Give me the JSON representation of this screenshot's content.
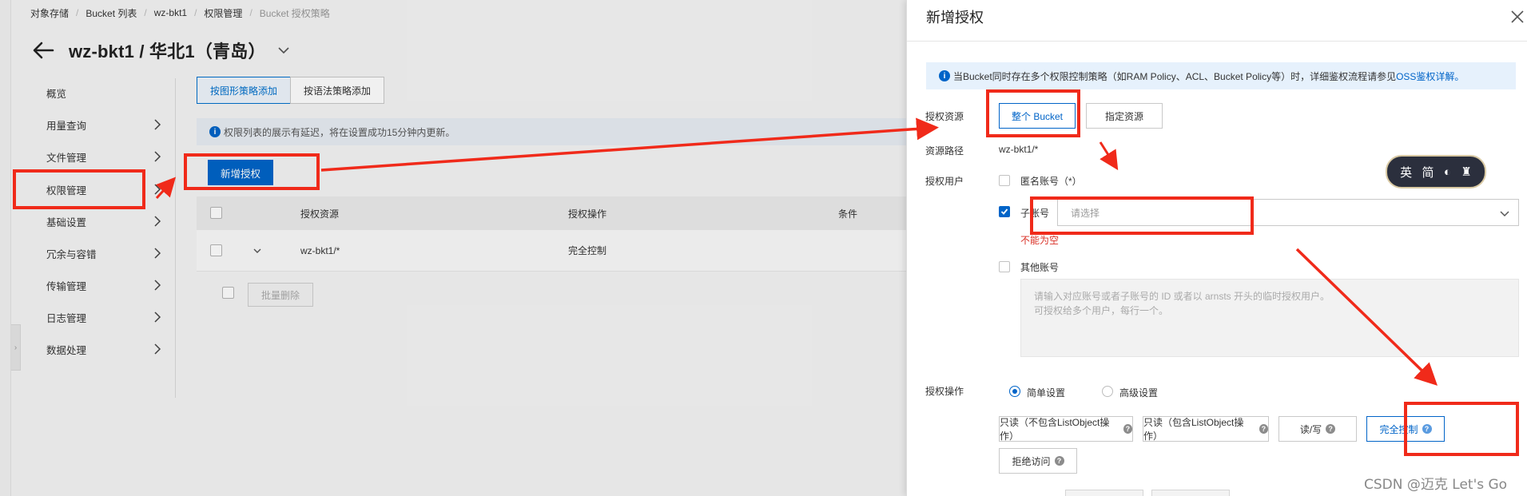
{
  "breadcrumb": [
    "对象存储",
    "Bucket 列表",
    "wz-bkt1",
    "权限管理",
    "Bucket 授权策略"
  ],
  "page": {
    "title": "wz-bkt1 / 华北1（青岛）"
  },
  "sidebar": {
    "items": [
      {
        "label": "概览",
        "has_arrow": false
      },
      {
        "label": "用量查询",
        "has_arrow": true
      },
      {
        "label": "文件管理",
        "has_arrow": true
      },
      {
        "label": "权限管理",
        "has_arrow": true
      },
      {
        "label": "基础设置",
        "has_arrow": true
      },
      {
        "label": "冗余与容错",
        "has_arrow": true
      },
      {
        "label": "传输管理",
        "has_arrow": true
      },
      {
        "label": "日志管理",
        "has_arrow": true
      },
      {
        "label": "数据处理",
        "has_arrow": true
      }
    ]
  },
  "content": {
    "tabs": [
      "按图形策略添加",
      "按语法策略添加"
    ],
    "notice": "权限列表的展示有延迟，将在设置成功15分钟内更新。",
    "add_button": "新增授权",
    "table": {
      "headers": [
        "授权资源",
        "授权操作",
        "条件"
      ],
      "rows": [
        {
          "resource": "wz-bkt1/*",
          "operation": "完全控制"
        }
      ]
    },
    "batch_delete": "批量删除"
  },
  "drawer": {
    "title": "新增授权",
    "alert": {
      "text": "当Bucket同时存在多个权限控制策略（如RAM Policy、ACL、Bucket Policy等）时，详细鉴权流程请参见",
      "link": "OSS鉴权详解。"
    },
    "resource": {
      "label": "授权资源",
      "options": [
        "整个 Bucket",
        "指定资源"
      ],
      "selected": "整个 Bucket"
    },
    "path": {
      "label": "资源路径",
      "value": "wz-bkt1/*"
    },
    "users": {
      "label": "授权用户",
      "anonymous": "匿名账号（*）",
      "sub_account": "子账号",
      "sub_placeholder": "请选择",
      "error": "不能为空",
      "other": "其他账号",
      "other_placeholder_1": "请输入对应账号或者子账号的 ID 或者以 arnsts 开头的临时授权用户。",
      "other_placeholder_2": "可授权给多个用户，每行一个。"
    },
    "operation": {
      "label": "授权操作",
      "modes": [
        "简单设置",
        "高级设置"
      ],
      "selected_mode": "简单设置",
      "permissions": [
        "只读（不包含ListObject操作）",
        "只读（包含ListObject操作）",
        "读/写",
        "完全控制",
        "拒绝访问"
      ],
      "selected_permission": "完全控制"
    }
  },
  "lang_widget": [
    "英",
    "简"
  ],
  "watermark": "CSDN @迈克 Let's Go",
  "colors": {
    "primary": "#0064c8",
    "annotation": "#f02a1a",
    "error": "#d93026"
  }
}
